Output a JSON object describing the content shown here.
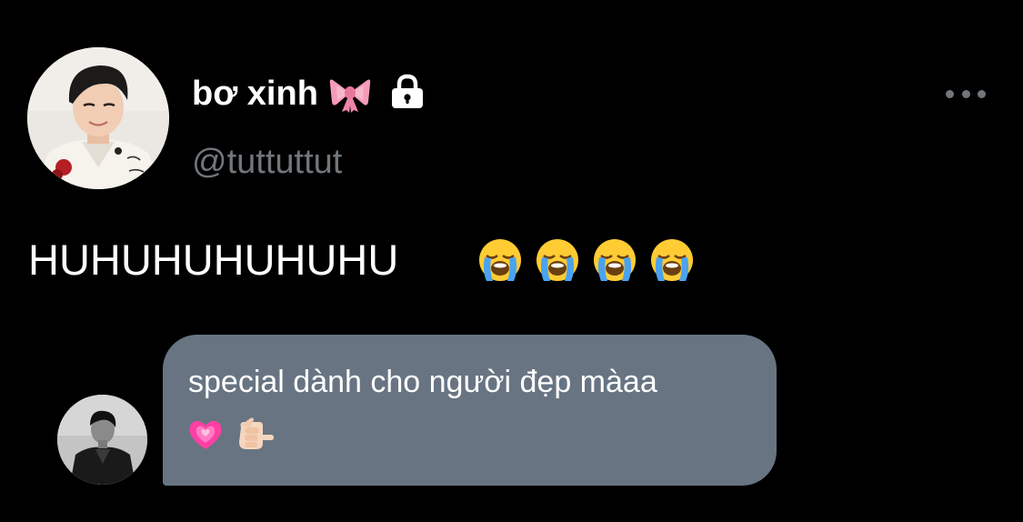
{
  "profile": {
    "display_name": "bơ xinh",
    "name_emoji": "ribbon-bow-icon",
    "protected_icon": "lock-icon",
    "handle": "@tuttuttut"
  },
  "header": {
    "more_icon": "more-horizontal-icon"
  },
  "tweet": {
    "text": "HUHUHUHUHUHU",
    "emojis": [
      "loudly-crying-face-icon",
      "loudly-crying-face-icon",
      "loudly-crying-face-icon",
      "loudly-crying-face-icon"
    ]
  },
  "message": {
    "text": "special dành cho người đẹp màaa",
    "emojis": [
      "growing-heart-icon",
      "pointing-fist-icon"
    ]
  },
  "colors": {
    "background": "#000000",
    "primary_text": "#ffffff",
    "secondary_text": "#71767b",
    "bubble": "#687482",
    "bow_pink": "#f59bb8",
    "heart_pink": "#ff3fa4",
    "emoji_yellow": "#ffcc33",
    "tear_blue": "#4aa3f0"
  }
}
